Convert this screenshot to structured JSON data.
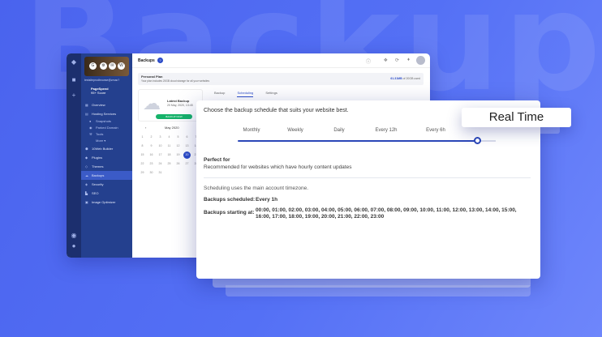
{
  "background": {
    "word": "Backup"
  },
  "app": {
    "sidebar": {
      "site_thumb_icons": [
        "G",
        "⚙",
        "✉",
        "W"
      ],
      "domain": "testsiteprodbrowse@zmac?",
      "speed_title": "PageSpeed",
      "speed_score": "95+ Score",
      "items": [
        {
          "label": "Overview",
          "icon": "grid-icon",
          "glyph": "▦"
        },
        {
          "label": "Hosting Services",
          "icon": "server-icon",
          "glyph": "▤"
        },
        {
          "label": "Snapshots",
          "sub": true,
          "icon": "camera-icon",
          "glyph": "●"
        },
        {
          "label": "Parked Domain",
          "sub": true,
          "icon": "globe-icon",
          "glyph": "◉"
        },
        {
          "label": "Tools",
          "sub": true,
          "icon": "wrench-icon",
          "glyph": "⚒"
        },
        {
          "label": "More ▾",
          "sub": true,
          "icon": "",
          "glyph": ""
        },
        {
          "label": "10Web Builder",
          "icon": "cube-icon",
          "glyph": "⬢"
        },
        {
          "label": "Plugins",
          "icon": "plug-icon",
          "glyph": "◆"
        },
        {
          "label": "Themes",
          "icon": "brush-icon",
          "glyph": "◇"
        },
        {
          "label": "Backups",
          "icon": "cloud-icon",
          "glyph": "☁",
          "active": true
        },
        {
          "label": "Security",
          "icon": "shield-icon",
          "glyph": "◈"
        },
        {
          "label": "SEO",
          "icon": "chart-icon",
          "glyph": "▙"
        },
        {
          "label": "Image Optimizer",
          "icon": "image-icon",
          "glyph": "▣"
        }
      ]
    },
    "header": {
      "title": "Backups",
      "help": "?"
    },
    "plan": {
      "name": "Personal Plan",
      "desc": "Your plan includes 20GB cloud storage for all your websites",
      "usage_used": "61.31MB",
      "usage_rest": "of 20GB used"
    },
    "tabs": [
      "Backup",
      "Scheduling",
      "Settings"
    ],
    "latest": {
      "title": "Latest Backup",
      "date": "20 May, 2020, 13:45",
      "button": "BACKUP NOW"
    },
    "calendar": {
      "prev": "‹",
      "month": "May 2020",
      "days": [
        "1",
        "2",
        "3",
        "4",
        "5",
        "6",
        "7",
        "8",
        "9",
        "10",
        "11",
        "12",
        "13",
        "14",
        "15",
        "16",
        "17",
        "18",
        "19",
        "20",
        "21",
        "22",
        "23",
        "24",
        "25",
        "26",
        "27",
        "28",
        "29",
        "30",
        "31"
      ],
      "selected": "20"
    }
  },
  "schedule": {
    "intro": "Choose the backup schedule that suits your website best.",
    "frequencies": [
      "Monthly",
      "Weekly",
      "Daily",
      "Every 12h",
      "Every 6h"
    ],
    "slider_value_fraction": 1,
    "perfect_for_label": "Perfect for",
    "recommendation": "Recommended for websites which have hourly content updates",
    "timezone_note": "Scheduling uses the main account timezone.",
    "scheduled_label": "Backups scheduled:",
    "scheduled_value": "Every 1h",
    "starting_label": "Backups starting at:",
    "starting_times": "00:00, 01:00, 02:00, 03:00, 04:00, 05:00, 06:00, 07:00, 08:00, 09:00, 10:00, 11:00, 12:00, 13:00, 14:00, 15:00, 16:00, 17:00, 18:00, 19:00, 20:00, 21:00, 22:00, 23:00"
  },
  "realtime": {
    "label": "Real Time"
  }
}
